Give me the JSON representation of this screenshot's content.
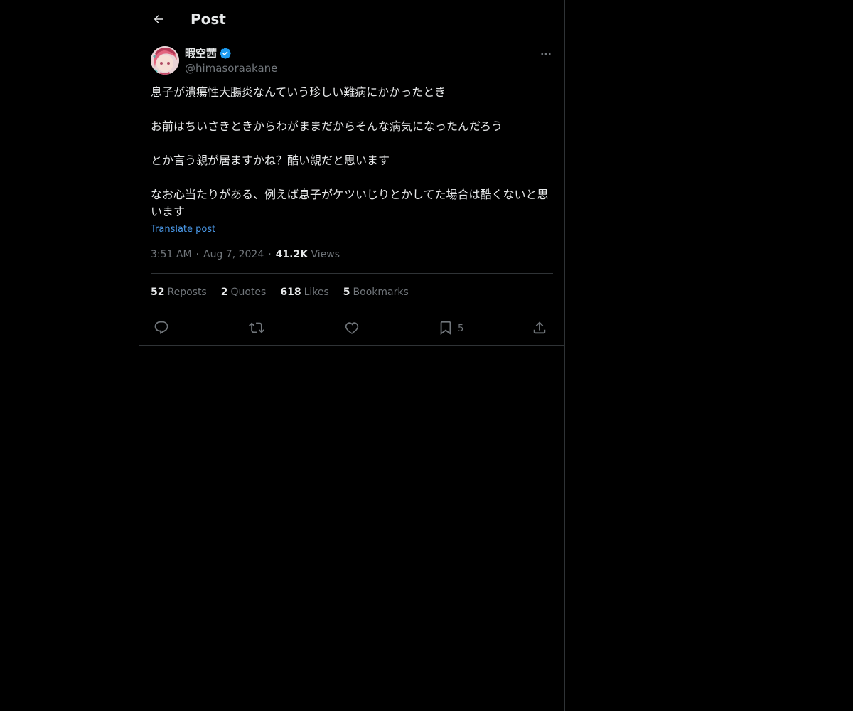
{
  "header": {
    "title": "Post"
  },
  "author": {
    "name": "暇空茜",
    "handle": "@himasoraakane",
    "verified": true
  },
  "tweet": {
    "paragraphs": [
      "息子が潰瘍性大腸炎なんていう珍しい難病にかかったとき",
      "お前はちいさきときからわがままだからそんな病気になったんだろう",
      "とか言う親が居ますかね？酷い親だと思います",
      "なお心当たりがある、例えば息子がケツいじりとかしてた場合は酷くないと思います"
    ],
    "translate_label": "Translate post",
    "time": "3:51 AM",
    "date": "Aug 7, 2024",
    "views_count": "41.2K",
    "views_label": "Views"
  },
  "stats": {
    "reposts": {
      "count": "52",
      "label": "Reposts"
    },
    "quotes": {
      "count": "2",
      "label": "Quotes"
    },
    "likes": {
      "count": "618",
      "label": "Likes"
    },
    "bookmarks": {
      "count": "5",
      "label": "Bookmarks"
    }
  },
  "actions": {
    "bookmark_count": "5"
  },
  "colors": {
    "background": "#000000",
    "text": "#e7e9ea",
    "secondary": "#71767b",
    "link": "#4a99e9",
    "border": "#2f3336",
    "verified": "#1d9bf0"
  },
  "icons": [
    "back-arrow-icon",
    "verified-badge-icon",
    "more-icon",
    "reply-icon",
    "repost-icon",
    "like-icon",
    "bookmark-icon",
    "share-icon"
  ]
}
